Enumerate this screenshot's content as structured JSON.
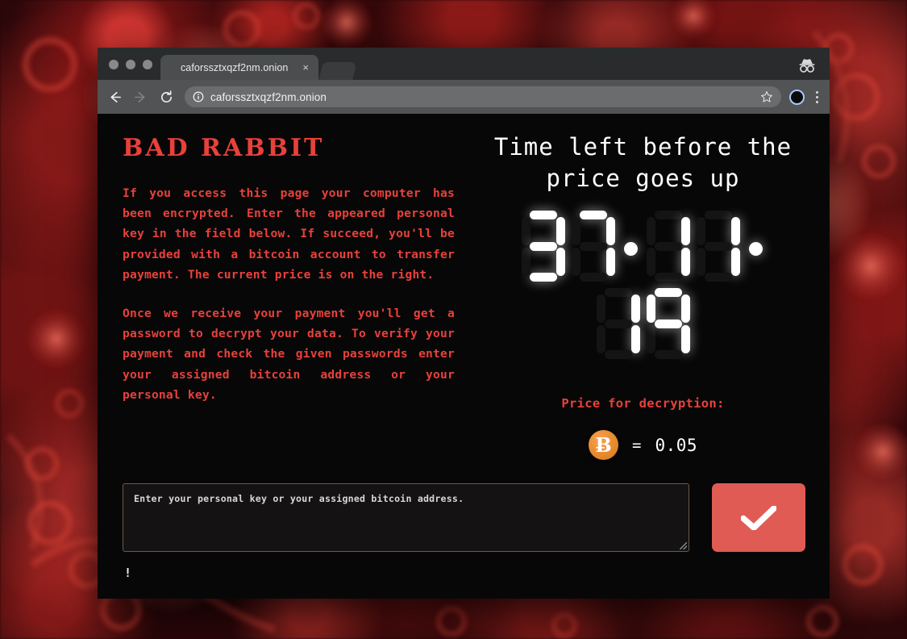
{
  "browser": {
    "tab": {
      "title": "caforssztxqzf2nm.onion",
      "close_label": "×"
    },
    "omnibox": {
      "url": "caforssztxqzf2nm.onion",
      "info_icon": "info-circle-icon",
      "star_icon": "star-icon"
    },
    "nav": {
      "back_icon": "back-arrow-icon",
      "forward_icon": "forward-arrow-icon",
      "reload_icon": "reload-icon"
    },
    "incognito_icon": "incognito-icon",
    "menu_icon": "kebab-menu-icon",
    "window_lights": [
      "close",
      "minimize",
      "maximize"
    ]
  },
  "page": {
    "brand": "BAD RABBIT",
    "paragraphs": [
      "If you access this page your computer has been encrypted. Enter the appeared personal key in the field below. If succeed, you'll be provided with a bitcoin account to transfer payment. The current price is on the right.",
      "Once we receive your payment you'll get a password to decrypt your data. To verify your payment and check the given passwords enter your assigned bitcoin address or your personal key."
    ],
    "timer": {
      "heading": "Time left before the price goes up",
      "row1": [
        "3",
        "7",
        ":",
        "1",
        "1",
        ":"
      ],
      "row2": [
        "1",
        "9"
      ],
      "display": "37:11:19"
    },
    "price": {
      "label": "Price for decryption:",
      "currency_symbol": "Ƀ",
      "equals": "=",
      "amount": "0.05"
    },
    "form": {
      "placeholder": "Enter your personal key or your assigned bitcoin address.",
      "value": "",
      "submit_icon": "checkmark-icon"
    },
    "warning_mark": "!"
  },
  "colors": {
    "accent_red": "#e8413a",
    "button_red": "#e15b55",
    "page_bg": "#080708",
    "bitcoin_orange": "#e88a2e",
    "segment_on": "#ffffff",
    "segment_off": "#141414"
  }
}
